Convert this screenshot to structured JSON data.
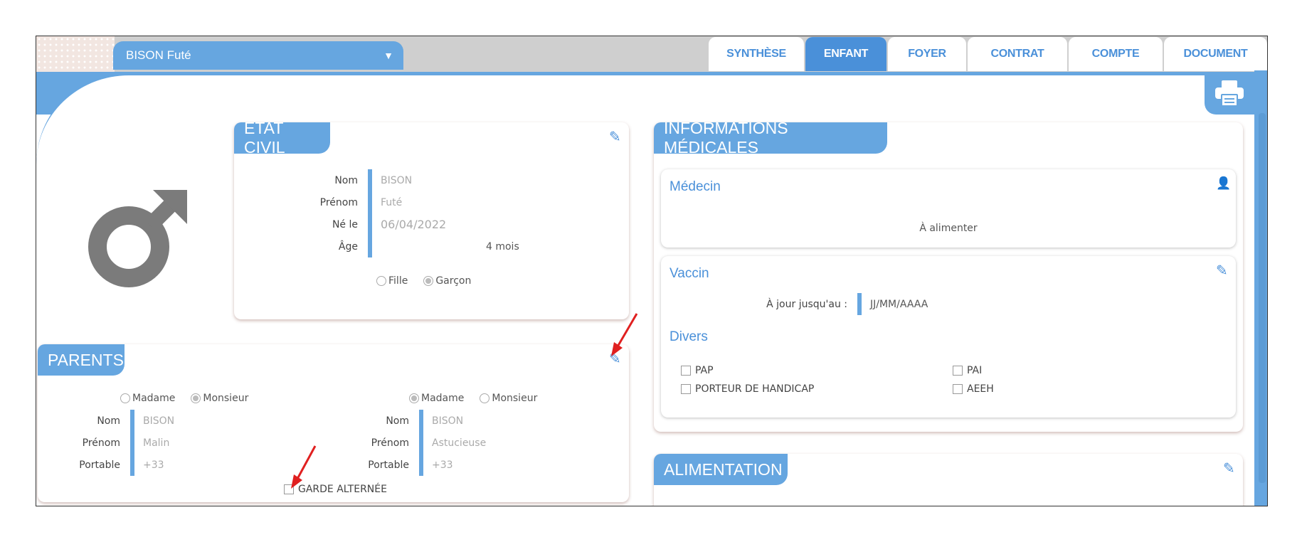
{
  "header": {
    "child_select": "BISON Futé",
    "tabs": [
      {
        "label": "SYNTHÈSE",
        "active": false
      },
      {
        "label": "ENFANT",
        "active": true
      },
      {
        "label": "FOYER",
        "active": false
      },
      {
        "label": "CONTRAT",
        "active": false
      },
      {
        "label": "COMPTE",
        "active": false
      },
      {
        "label": "DOCUMENT",
        "active": false
      }
    ],
    "print_icon": "printer-icon"
  },
  "etat_civil": {
    "title": "ÉTAT CIVIL",
    "fields": [
      {
        "label": "Nom",
        "value": "BISON"
      },
      {
        "label": "Prénom",
        "value": "Futé"
      },
      {
        "label": "Né le",
        "value": "06/04/2022"
      },
      {
        "label": "Âge",
        "value": "4 mois"
      }
    ],
    "sex_options": [
      {
        "label": "Fille",
        "checked": false
      },
      {
        "label": "Garçon",
        "checked": true
      }
    ]
  },
  "parents": {
    "title": "PARENTS",
    "parent1": {
      "civility": [
        {
          "label": "Madame",
          "checked": false
        },
        {
          "label": "Monsieur",
          "checked": true
        }
      ],
      "fields": [
        {
          "label": "Nom",
          "value": "BISON"
        },
        {
          "label": "Prénom",
          "value": "Malin"
        },
        {
          "label": "Portable",
          "value": "+33"
        }
      ]
    },
    "parent2": {
      "civility": [
        {
          "label": "Madame",
          "checked": true
        },
        {
          "label": "Monsieur",
          "checked": false
        }
      ],
      "fields": [
        {
          "label": "Nom",
          "value": "BISON"
        },
        {
          "label": "Prénom",
          "value": "Astucieuse"
        },
        {
          "label": "Portable",
          "value": "+33"
        }
      ]
    },
    "garde_alternee": "GARDE ALTERNÉE"
  },
  "medical": {
    "title": "INFORMATIONS MÉDICALES",
    "medecin": {
      "title": "Médecin",
      "empty_text": "À alimenter"
    },
    "vaccin": {
      "title": "Vaccin",
      "label": "À jour jusqu'au :",
      "value": "JJ/MM/AAAA"
    },
    "divers": {
      "title": "Divers",
      "items": [
        "PAP",
        "PAI",
        "PORTEUR DE HANDICAP",
        "AEEH"
      ]
    }
  },
  "alimentation": {
    "title": "ALIMENTATION"
  },
  "colors": {
    "accent": "#66a6e0",
    "tab_active": "#4a90d9",
    "annotation_arrow": "#e02020"
  }
}
